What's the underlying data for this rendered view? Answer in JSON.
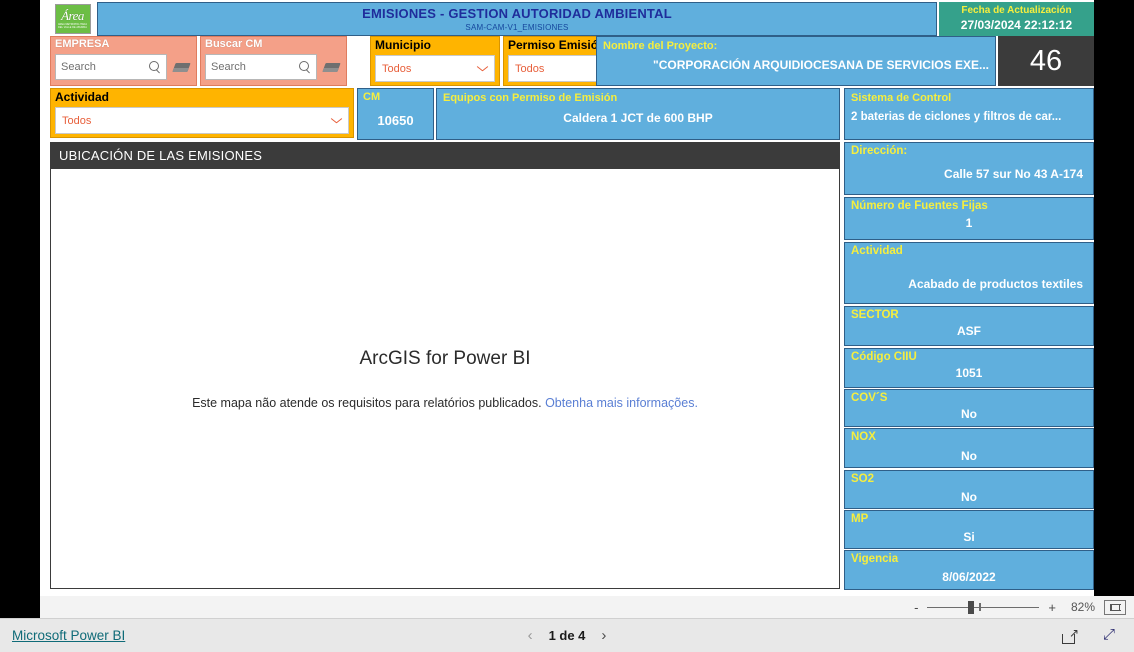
{
  "header": {
    "logo_script": "Área",
    "logo_sub": "AREA METROPOLITANA DEL VALLE DE ABURRA",
    "title": "EMISIONES - GESTION AUTORIDAD AMBIENTAL",
    "subtitle": "SAM-CAM-V1_EMISIONES",
    "update_label": "Fecha de Actualización",
    "update_value": "27/03/2024 22:12:12"
  },
  "slicers": {
    "empresa": {
      "title": "EMPRESA",
      "placeholder": "Search"
    },
    "buscar_cm": {
      "title": "Buscar CM",
      "placeholder": "Search"
    },
    "municipio": {
      "title": "Municipio",
      "value": "Todos"
    },
    "permiso": {
      "title": "Permiso Emisión",
      "value": "Todos"
    },
    "actividad": {
      "title": "Actividad",
      "value": "Todos"
    }
  },
  "cards": {
    "proyecto": {
      "label": "Nombre del Proyecto:",
      "value": "\"CORPORACIÓN ARQUIDIOCESANA DE SERVICIOS EXE..."
    },
    "count": {
      "value": "46"
    },
    "cm": {
      "label": "CM",
      "value": "10650"
    },
    "equipos": {
      "label": "Equipos con Permiso de Emisión",
      "value": "Caldera 1 JCT de 600 BHP"
    },
    "sistema_control": {
      "label": "Sistema de Control",
      "value": "2 baterias de ciclones y filtros de car..."
    }
  },
  "map": {
    "header": "UBICACIÓN DE LAS EMISIONES",
    "title": "ArcGIS for Power BI",
    "message": "Este mapa não atende os requisitos para relatórios publicados.",
    "link": "Obtenha mais informações."
  },
  "kpis": [
    {
      "label": "Dirección:",
      "value": "Calle 57 sur No 43 A-174",
      "align": "right"
    },
    {
      "label": "Número de Fuentes Fijas",
      "value": "1",
      "align": "center"
    },
    {
      "label": "Actividad",
      "value": "Acabado de productos textiles",
      "align": "right"
    },
    {
      "label": "SECTOR",
      "value": "ASF",
      "align": "center"
    },
    {
      "label": "Código CIIU",
      "value": "1051",
      "align": "center"
    },
    {
      "label": "COV´S",
      "value": "No",
      "align": "center"
    },
    {
      "label": "NOX",
      "value": "No",
      "align": "center"
    },
    {
      "label": "SO2",
      "value": "No",
      "align": "center"
    },
    {
      "label": "MP",
      "value": "Si",
      "align": "center"
    },
    {
      "label": "Vigencia",
      "value": "8/06/2022",
      "align": "center"
    }
  ],
  "zoombar": {
    "minus": "-",
    "plus": "+",
    "percent": "82%"
  },
  "footer": {
    "brand": "Microsoft Power BI",
    "prev": "‹",
    "next": "›",
    "page": "1 de 4",
    "share_arrow": "↗",
    "expand": "⤢"
  }
}
